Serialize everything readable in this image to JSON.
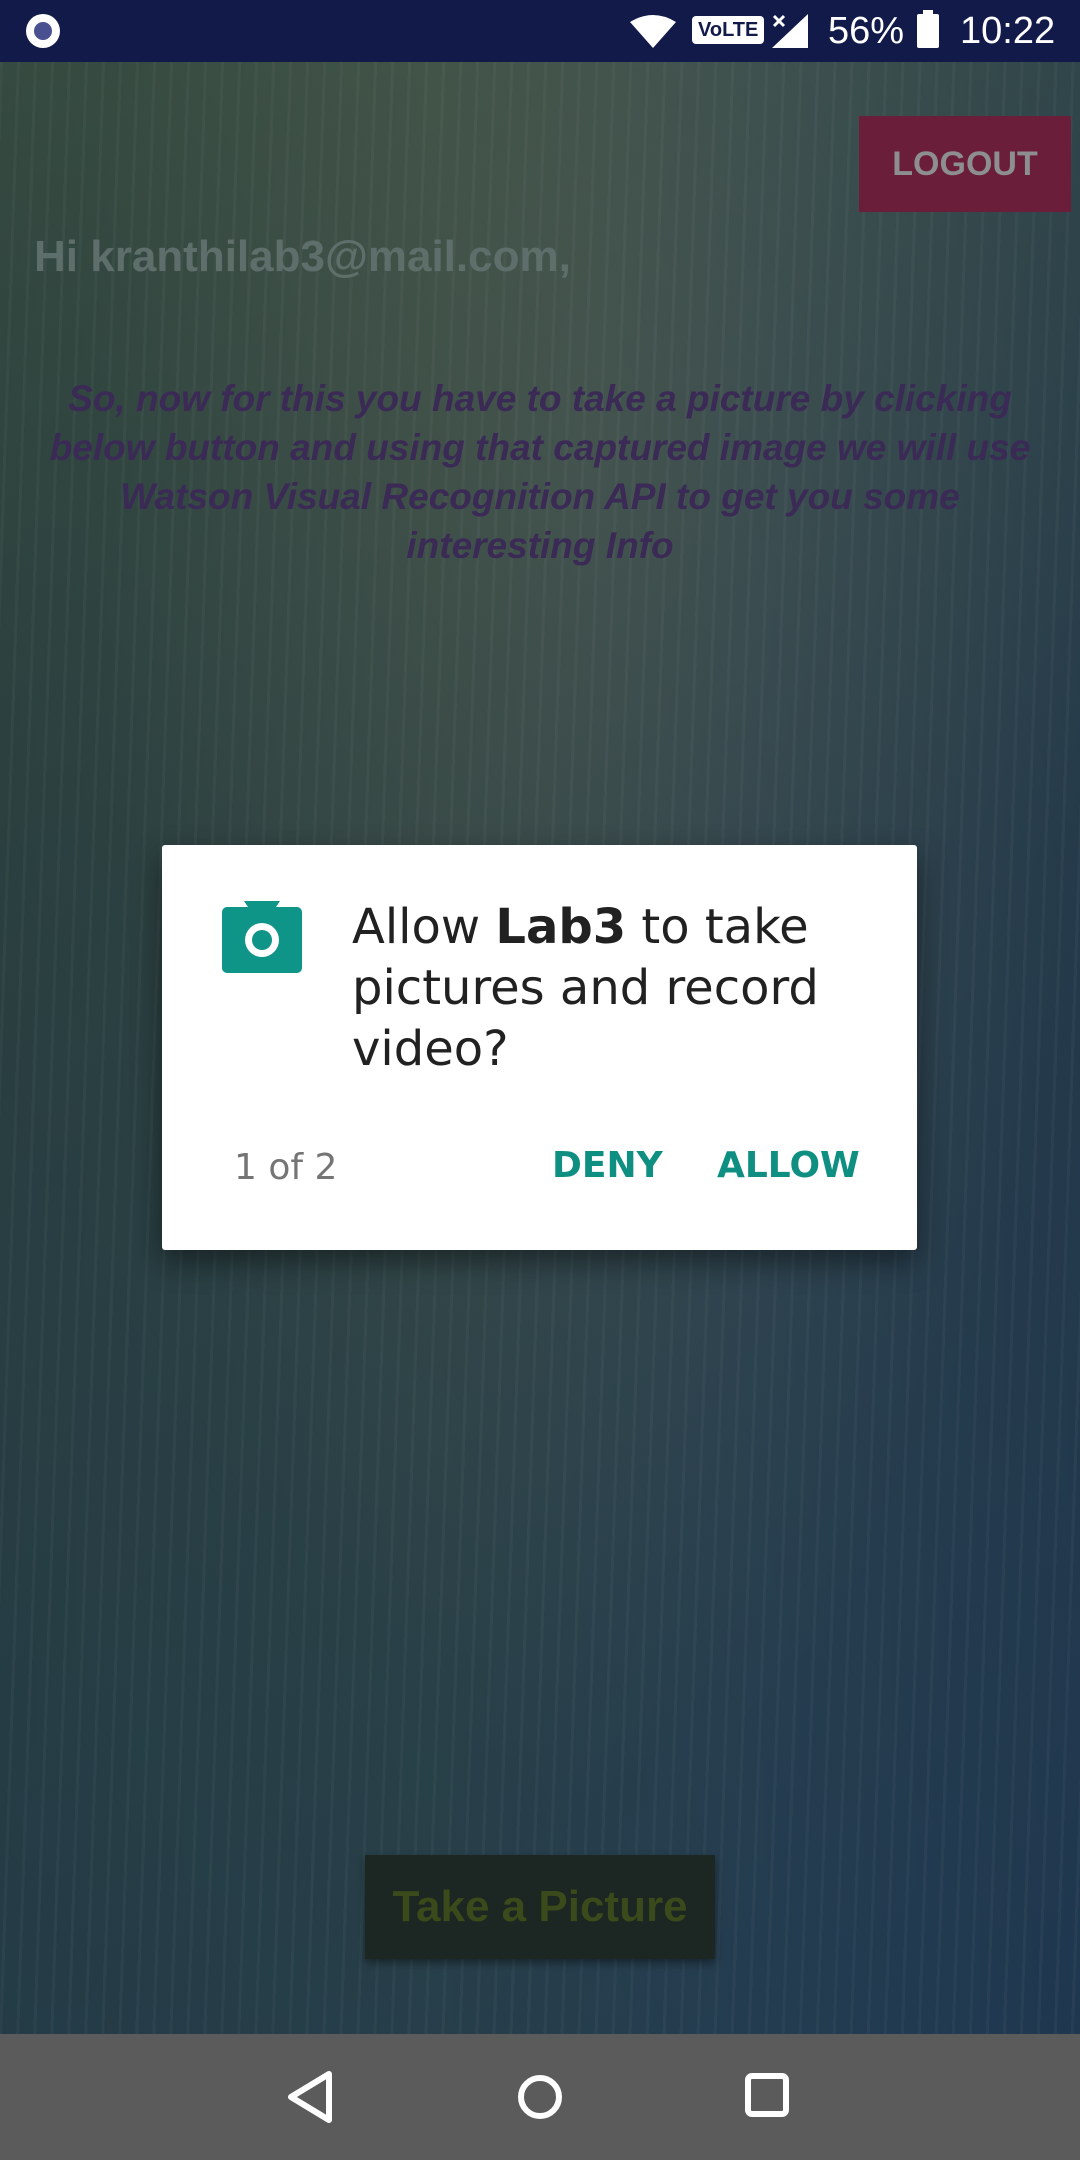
{
  "status_bar": {
    "network_badge": "VoLTE",
    "battery": "56%",
    "time": "10:22",
    "icons": [
      "notification-dot-icon",
      "wifi-icon",
      "signal-icon",
      "battery-icon"
    ]
  },
  "app": {
    "logout_label": "LOGOUT",
    "greeting": "Hi kranthilab3@mail.com,",
    "instructions": "So, now for this you have to take a picture by clicking below button and using that captured image we will use Watson Visual Recognition API to get you some interesting Info",
    "take_picture_label": "Take a Picture",
    "colors": {
      "logout_bg": "#6b1e3a",
      "instructions_text": "#3a2a55"
    }
  },
  "dialog": {
    "message_prefix": "Allow ",
    "app_name": "Lab3",
    "message_suffix": " to take pictures and record video?",
    "counter": "1 of 2",
    "deny_label": "DENY",
    "allow_label": "ALLOW",
    "icon": "camera-icon",
    "accent_color": "#0f8f82"
  },
  "nav_bar": {
    "icons": [
      "back-icon",
      "home-icon",
      "recents-icon"
    ]
  }
}
